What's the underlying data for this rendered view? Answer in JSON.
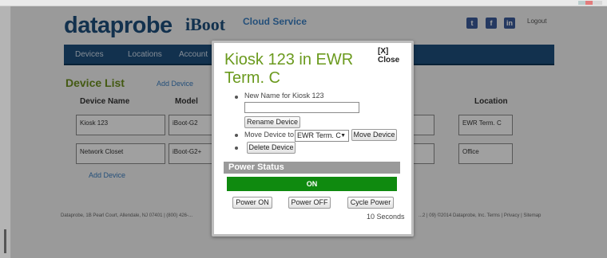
{
  "header": {
    "logo": "dataprobe",
    "product": "iBoot",
    "service": "Cloud Service",
    "social": [
      "twitter-icon",
      "facebook-icon",
      "linkedin-icon"
    ],
    "logout": "Logout"
  },
  "nav": {
    "items": [
      "Devices",
      "Locations",
      "Account"
    ]
  },
  "device_list": {
    "title": "Device List",
    "add_device": "Add Device",
    "columns": [
      "Device Name",
      "Model",
      "Location"
    ],
    "rows": [
      {
        "name": "Kiosk 123",
        "model": "iBoot-G2",
        "location": "EWR Term. C"
      },
      {
        "name": "Network Closet",
        "model": "iBoot-G2+",
        "location": "Office"
      }
    ],
    "add_device_bottom": "Add Device"
  },
  "footer": {
    "left": "Dataprobe, 1B Pearl Court, Allendale, NJ 07401 | (800) 426-...",
    "right": "...2 | 09) ©2014 Dataprobe, Inc. Terms | Privacy | Sitemap"
  },
  "modal": {
    "title": "Kiosk 123 in EWR Term. C",
    "close": "[X] Close",
    "new_name_label": "New Name for Kiosk 123",
    "new_name_value": "",
    "rename_button": "Rename Device",
    "move_label": "Move Device to",
    "move_selected": "EWR Term. C",
    "move_button": "Move Device",
    "delete_button": "Delete Device",
    "power_status_label": "Power Status",
    "power_state": "ON",
    "power_on_button": "Power ON",
    "power_off_button": "Power OFF",
    "cycle_button": "Cycle Power",
    "cycle_seconds": "10 Seconds"
  },
  "colors": {
    "brand_blue": "#1d4e7a",
    "title_green": "#6b9a1e",
    "status_on": "#0f8a0f"
  }
}
